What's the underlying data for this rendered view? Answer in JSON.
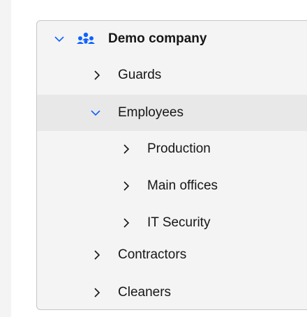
{
  "tree": {
    "root": {
      "label": "Demo company",
      "expanded": true,
      "icon": "people-group-icon"
    },
    "items": [
      {
        "label": "Guards",
        "expanded": false,
        "level": 1
      },
      {
        "label": "Employees",
        "expanded": true,
        "level": 1,
        "selected": true
      },
      {
        "label": "Production",
        "expanded": false,
        "level": 2
      },
      {
        "label": "Main offices",
        "expanded": false,
        "level": 2
      },
      {
        "label": "IT Security",
        "expanded": false,
        "level": 2
      },
      {
        "label": "Contractors",
        "expanded": false,
        "level": 1
      },
      {
        "label": "Cleaners",
        "expanded": false,
        "level": 1
      }
    ]
  },
  "colors": {
    "accent": "#0f62fe",
    "chevron_root": "#0f62fe",
    "chevron": "#161616",
    "selected_row": "#e8e8e8"
  }
}
